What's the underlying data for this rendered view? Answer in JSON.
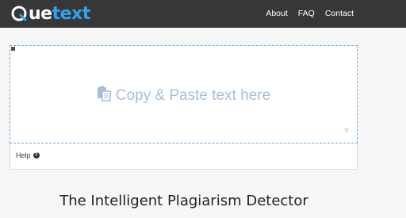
{
  "brand": {
    "logo_text_1": "ue",
    "logo_text_2": "text"
  },
  "nav": {
    "items": [
      {
        "label": "About"
      },
      {
        "label": "FAQ"
      },
      {
        "label": "Contact"
      }
    ]
  },
  "editor": {
    "placeholder": "Copy & Paste text here",
    "help_label": "Help"
  },
  "hero": {
    "title": "The Intelligent Plagiarism Detector"
  },
  "colors": {
    "navbar": "#373737",
    "brand_blue": "#2ea3f2",
    "placeholder": "#a7bfd6"
  }
}
